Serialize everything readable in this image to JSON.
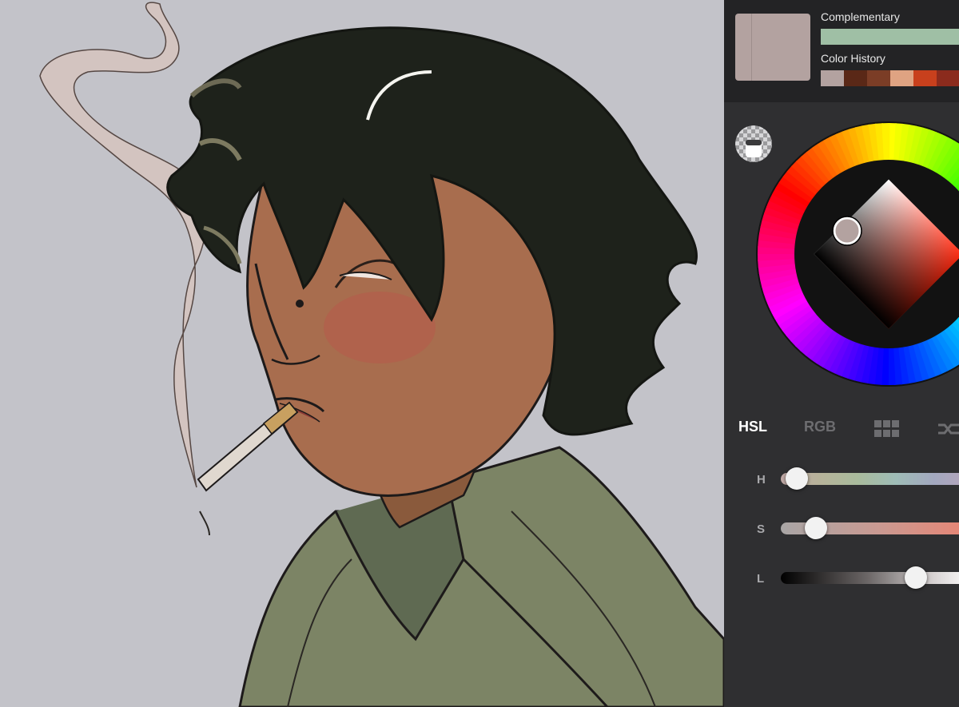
{
  "panel": {
    "current_color": "#b3a2a0",
    "complementary_label": "Complementary",
    "complementary_color": "#9fbfa5",
    "history_label": "Color History",
    "history": [
      "#b3a2a0",
      "#5a2817",
      "#7b3d26",
      "#dfa382",
      "#c8401d",
      "#8b2b1d"
    ]
  },
  "tabs": {
    "hsl": "HSL",
    "rgb": "RGB"
  },
  "sliders": {
    "h_label": "H",
    "h_value": 0.085,
    "s_label": "S",
    "s_value": 0.185,
    "l_label": "L",
    "l_value": 0.705
  },
  "wheel": {
    "indicator": "#b3a2a0"
  }
}
